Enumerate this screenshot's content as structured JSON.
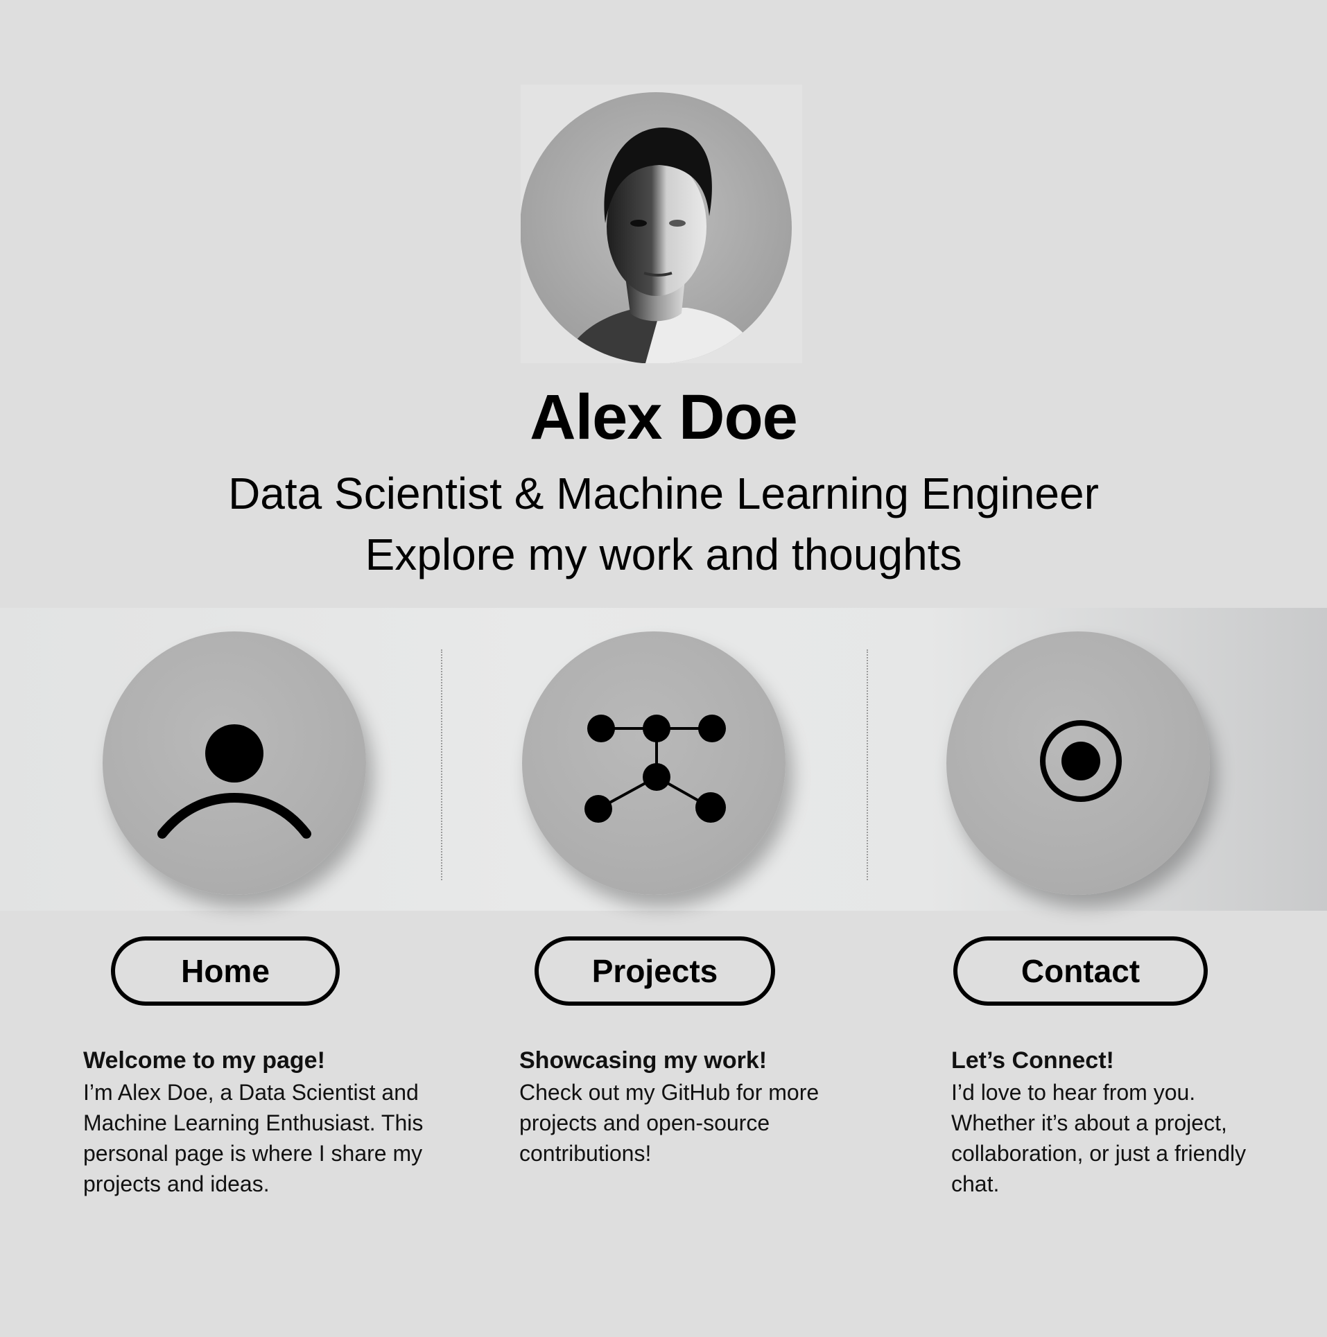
{
  "profile": {
    "name": "Alex Doe",
    "subtitle": "Data Scientist & Machine Learning Engineer",
    "tagline": "Explore my work and thoughts",
    "avatar_icon": "portrait-photo"
  },
  "nav": [
    {
      "id": "home",
      "label": "Home",
      "icon": "user-icon",
      "title": "Welcome to my page!",
      "body": "I’m Alex Doe, a Data Scientist and Machine Learning Enthusiast. This personal page is where I share my projects and ideas."
    },
    {
      "id": "projects",
      "label": "Projects",
      "icon": "network-icon",
      "title": "Showcasing my work!",
      "body": "Check out my GitHub for more projects and open-source contributions!"
    },
    {
      "id": "contact",
      "label": "Contact",
      "icon": "target-icon",
      "title": "Let’s Connect!",
      "body": "I’d love to hear from you. Whether it’s about a project, collaboration, or just a friendly chat."
    }
  ],
  "colors": {
    "background": "#dedede",
    "disc": "#b2b2b2",
    "ink": "#000000"
  }
}
